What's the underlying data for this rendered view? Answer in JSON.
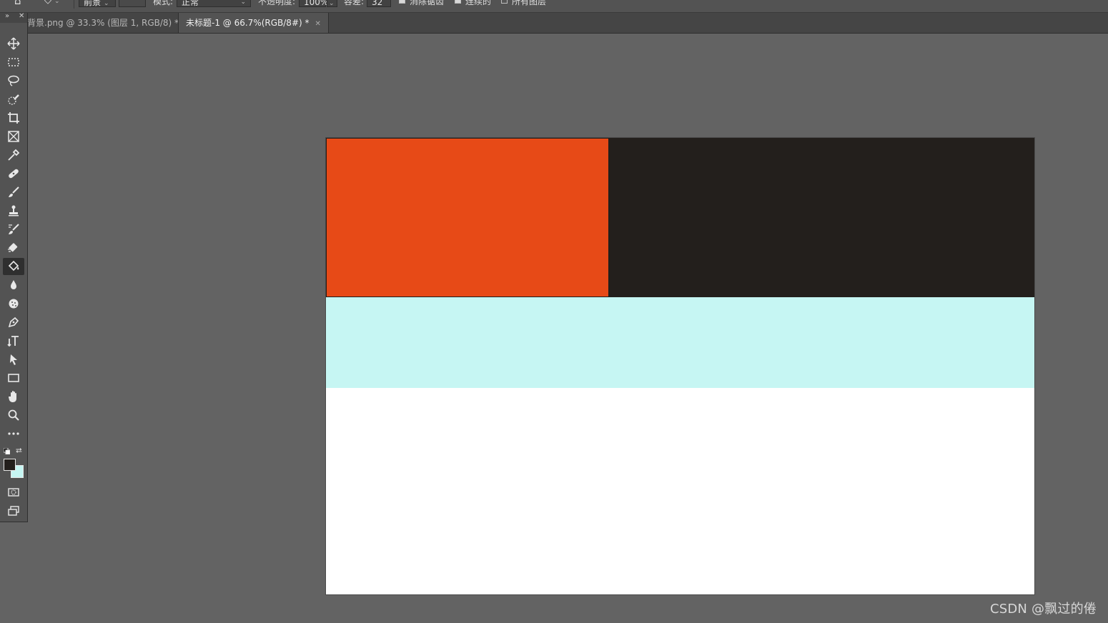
{
  "options_bar": {
    "fill_source": "前景",
    "mode_label": "模式:",
    "mode_value": "正常",
    "opacity_label": "不透明度:",
    "opacity_value": "100%",
    "tolerance_label": "容差:",
    "tolerance_value": "32",
    "anti_alias_label": "消除锯齿",
    "contiguous_label": "连续的",
    "all_layers_label": "所有图层"
  },
  "tabs": [
    {
      "label": "背景.png @ 33.3% (图层 1, RGB/8) *",
      "active": false
    },
    {
      "label": "未标题-1 @ 66.7%(RGB/8#) *",
      "active": true
    }
  ],
  "toolbar": {
    "tools": [
      "move-tool",
      "rectangular-marquee-tool",
      "lasso-tool",
      "quick-selection-tool",
      "crop-tool",
      "frame-tool",
      "eyedropper-tool",
      "healing-brush-tool",
      "brush-tool",
      "clone-stamp-tool",
      "history-brush-tool",
      "eraser-tool",
      "paint-bucket-tool",
      "blur-tool",
      "dodge-tool",
      "pen-tool",
      "type-tool",
      "path-selection-tool",
      "rectangle-tool",
      "hand-tool",
      "zoom-tool",
      "edit-toolbar"
    ],
    "active_tool": "paint-bucket-tool",
    "foreground_color": "#231f1c",
    "background_color": "#c6f6f3"
  },
  "canvas": {
    "colors": {
      "orange": "#e74a17",
      "dark": "#231f1c",
      "cyan": "#c6f6f3",
      "white": "#ffffff"
    }
  },
  "watermark": "CSDN @飘过的倦"
}
